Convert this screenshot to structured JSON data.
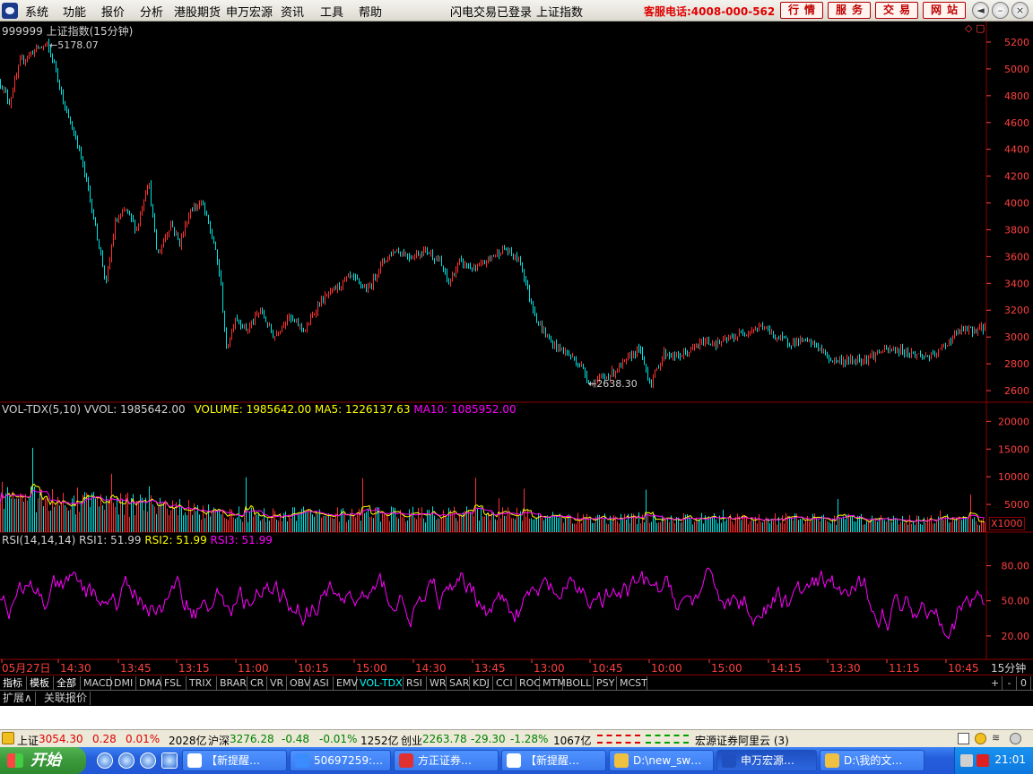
{
  "menubar": {
    "items": [
      "系统",
      "功能",
      "报价",
      "分析",
      "港股期货",
      "申万宏源",
      "资讯",
      "工具",
      "帮助"
    ],
    "status": "闪电交易已登录",
    "index_name": "上证指数",
    "hotline": "客服电话:4008-000-562",
    "buttons": [
      "行情",
      "服务",
      "交易",
      "网站"
    ]
  },
  "chart_data": [
    {
      "type": "line",
      "title": "999999 上证指数(15分钟)",
      "y_ticks": [
        2600,
        2800,
        3000,
        3200,
        3400,
        3600,
        3800,
        4000,
        4200,
        4400,
        4600,
        4800,
        5000,
        5200
      ],
      "ylim": [
        2520,
        5260
      ],
      "annotations": [
        {
          "label": "5178.07",
          "value": 5178.07
        },
        {
          "label": "2638.30",
          "value": 2638.3
        }
      ],
      "x_ticks": [
        "05月27日",
        "14:30",
        "13:45",
        "13:15",
        "11:00",
        "10:15",
        "15:00",
        "14:30",
        "13:45",
        "13:00",
        "10:45",
        "10:00",
        "15:00",
        "14:15",
        "13:30",
        "11:15",
        "10:45"
      ],
      "waypoints": [
        [
          0,
          4900
        ],
        [
          10,
          4750
        ],
        [
          22,
          5050
        ],
        [
          40,
          5150
        ],
        [
          52,
          5178
        ],
        [
          62,
          5000
        ],
        [
          72,
          4700
        ],
        [
          86,
          4450
        ],
        [
          98,
          4100
        ],
        [
          108,
          3750
        ],
        [
          118,
          3400
        ],
        [
          128,
          3850
        ],
        [
          140,
          3950
        ],
        [
          152,
          3800
        ],
        [
          165,
          4180
        ],
        [
          175,
          3600
        ],
        [
          190,
          3850
        ],
        [
          200,
          3700
        ],
        [
          212,
          3950
        ],
        [
          225,
          4000
        ],
        [
          238,
          3700
        ],
        [
          245,
          3450
        ],
        [
          252,
          2900
        ],
        [
          262,
          3150
        ],
        [
          275,
          3050
        ],
        [
          290,
          3200
        ],
        [
          305,
          3000
        ],
        [
          320,
          3150
        ],
        [
          340,
          3050
        ],
        [
          355,
          3250
        ],
        [
          372,
          3350
        ],
        [
          390,
          3450
        ],
        [
          410,
          3350
        ],
        [
          425,
          3550
        ],
        [
          440,
          3650
        ],
        [
          458,
          3600
        ],
        [
          475,
          3650
        ],
        [
          490,
          3560
        ],
        [
          500,
          3400
        ],
        [
          512,
          3560
        ],
        [
          530,
          3500
        ],
        [
          548,
          3600
        ],
        [
          562,
          3660
        ],
        [
          580,
          3560
        ],
        [
          590,
          3300
        ],
        [
          600,
          3100
        ],
        [
          615,
          2950
        ],
        [
          632,
          2880
        ],
        [
          648,
          2780
        ],
        [
          658,
          2650
        ],
        [
          668,
          2680
        ],
        [
          680,
          2720
        ],
        [
          695,
          2800
        ],
        [
          712,
          2920
        ],
        [
          725,
          2650
        ],
        [
          740,
          2880
        ],
        [
          755,
          2850
        ],
        [
          770,
          2900
        ],
        [
          785,
          2970
        ],
        [
          800,
          2950
        ],
        [
          818,
          3000
        ],
        [
          835,
          3050
        ],
        [
          850,
          3080
        ],
        [
          865,
          3000
        ],
        [
          880,
          2960
        ],
        [
          895,
          2970
        ],
        [
          910,
          2940
        ],
        [
          925,
          2830
        ],
        [
          945,
          2820
        ],
        [
          965,
          2840
        ],
        [
          985,
          2900
        ],
        [
          1005,
          2900
        ],
        [
          1020,
          2870
        ],
        [
          1040,
          2850
        ],
        [
          1055,
          2950
        ],
        [
          1070,
          3050
        ],
        [
          1085,
          3050
        ],
        [
          1100,
          3080
        ]
      ]
    },
    {
      "type": "bar",
      "title": "VOL-TDX(5,10)",
      "series": [
        {
          "name": "VVOL",
          "value": "1985642.00"
        },
        {
          "name": "VOLUME",
          "value": "1985642.00"
        },
        {
          "name": "MA5",
          "value": "1226137.63"
        },
        {
          "name": "MA10",
          "value": "1085952.00"
        }
      ],
      "y_ticks": [
        5000,
        10000,
        15000,
        20000
      ],
      "ylim": [
        0,
        22000
      ],
      "unit": "X1000"
    },
    {
      "type": "line",
      "title": "RSI(14,14,14)",
      "series": [
        {
          "name": "RSI1",
          "value": "51.99"
        },
        {
          "name": "RSI2",
          "value": "51.99"
        },
        {
          "name": "RSI3",
          "value": "51.99"
        }
      ],
      "y_ticks": [
        20.0,
        50.0,
        80.0
      ],
      "ylim": [
        0,
        98
      ]
    }
  ],
  "period_label": "15分钟",
  "tabs": [
    "指标",
    "模板",
    "全部",
    "MACD",
    "DMI",
    "DMA",
    "FSL",
    "TRIX",
    "BRAR",
    "CR",
    "VR",
    "OBV",
    "ASI",
    "EMV",
    "VOL-TDX",
    "RSI",
    "WR",
    "SAR",
    "KDJ",
    "CCI",
    "ROC",
    "MTM",
    "BOLL",
    "PSY",
    "MCST"
  ],
  "tab_right": [
    "+",
    "-",
    "0"
  ],
  "ext_row": [
    "扩展∧",
    "关联报价"
  ],
  "ticker": {
    "sh_label": "上证",
    "sh_value": "3054.30",
    "sh_change": "0.28",
    "sh_pct": "0.01%",
    "sh_amount": "2028亿",
    "hs_label": "沪深",
    "hs_value": "3276.28",
    "hs_change": "-0.48",
    "hs_pct": "-0.01%",
    "hs_amount": "1252亿",
    "cy_label": "创业",
    "cy_value": "2263.78",
    "cy_change": "-29.30",
    "cy_pct": "-1.28%",
    "cy_amount": "1067亿",
    "broker": "宏源证券阿里云 (3)"
  },
  "taskbar": {
    "start": "开始",
    "tasks": [
      "【新提醒…",
      "50697259:…",
      "方正证券…",
      "【新提醒…",
      "D:\\new_sw…",
      "申万宏源…",
      "D:\\我的文…"
    ],
    "clock": "21:01"
  },
  "colors": {
    "up": "#ff3030",
    "down": "#00e0e0",
    "ma5": "#ffff00",
    "ma10": "#ff00ff",
    "axis": "#8b0000"
  }
}
